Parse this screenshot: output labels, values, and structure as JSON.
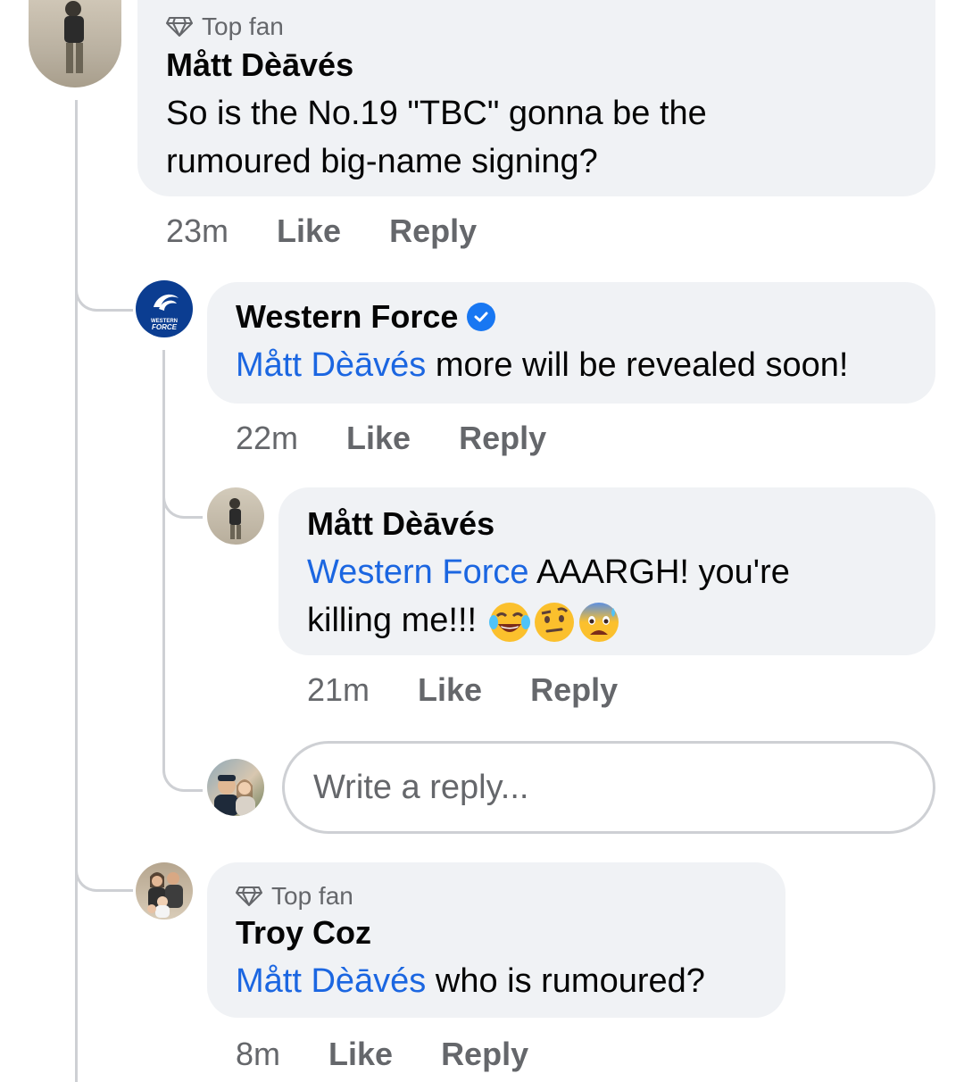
{
  "colors": {
    "mention": "#1b66e1",
    "bubble": "#f0f2f5",
    "meta": "#65676b",
    "verified": "#1877f2"
  },
  "comments": [
    {
      "badge": "Top fan",
      "badge_icon": "diamond-icon",
      "author": "Mått Dèāvés",
      "mention": "",
      "text_line1": "So is the No.19 \"TBC\" gonna be the",
      "text_line2": "rumoured big-name signing?",
      "time": "23m",
      "like": "Like",
      "reply": "Reply"
    },
    {
      "author": "Western Force",
      "verified_icon": "verified-badge-icon",
      "mention": "Mått Dèāvés",
      "text": " more will be revealed soon!",
      "time": "22m",
      "like": "Like",
      "reply": "Reply",
      "avatar_text_1": "WESTERN",
      "avatar_text_2": "FORCE"
    },
    {
      "author": "Mått Dèāvés",
      "mention": "Western Force",
      "text_line1": " AAARGH! you're",
      "text_line2": "killing me!!! ",
      "emojis": [
        "tears-of-joy-emoji",
        "raised-eyebrow-emoji",
        "anxious-sweat-emoji"
      ],
      "time": "21m",
      "like": "Like",
      "reply": "Reply"
    },
    {
      "badge": "Top fan",
      "badge_icon": "diamond-icon",
      "author": "Troy Coz",
      "mention": "Mått Dèāvés",
      "text": " who is rumoured?",
      "time": "8m",
      "like": "Like",
      "reply": "Reply"
    }
  ],
  "reply_input": {
    "placeholder": "Write a reply..."
  }
}
